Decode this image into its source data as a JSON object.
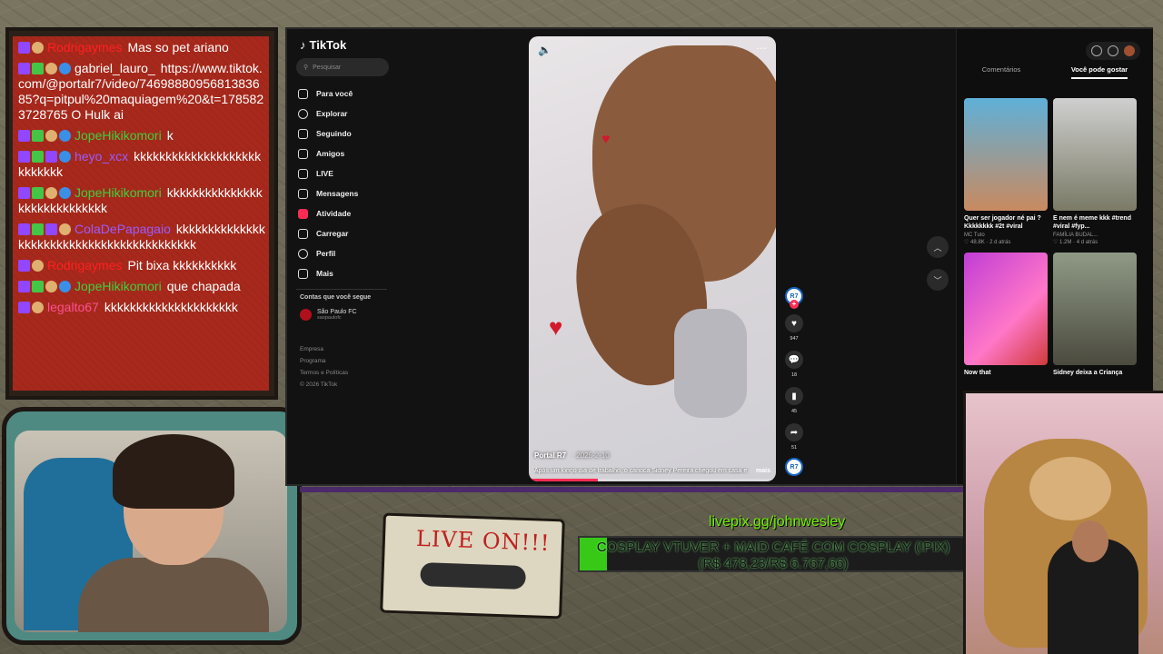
{
  "chat": {
    "messages": [
      {
        "user": "Rodrigaymes",
        "user_color": "#ff2020",
        "text": "Mas so pet ariano",
        "badges": [
          "purple",
          "face"
        ]
      },
      {
        "user": "gabriel_lauro_",
        "user_color": "#ffffff",
        "text": "https://www.tiktok.com/@portalr7/video/7469888095681383685?q=pitpul%20maquiagem%20&t=1785823728765 O Hulk ai",
        "badges": [
          "purple",
          "green",
          "face",
          "blue"
        ]
      },
      {
        "user": "JopeHikikomori",
        "user_color": "#3cd13c",
        "text": "k",
        "badges": [
          "purple",
          "green",
          "face",
          "blue"
        ]
      },
      {
        "user": "heyo_xcx",
        "user_color": "#9b5cff",
        "text": "kkkkkkkkkkkkkkkkkkkkkkkkkkk",
        "badges": [
          "purple",
          "green",
          "purple",
          "blue"
        ]
      },
      {
        "user": "JopeHikikomori",
        "user_color": "#3cd13c",
        "text": "kkkkkkkkkkkkkkkkkkkkkkkkkkkkk",
        "badges": [
          "purple",
          "green",
          "face",
          "blue"
        ]
      },
      {
        "user": "ColaDePapagaio",
        "user_color": "#9b5cff",
        "text": "kkkkkkkkkkkkkkkkkkkkkkkkkkkkkkkkkkkkkkkkkk",
        "badges": [
          "purple",
          "green",
          "purple",
          "face"
        ]
      },
      {
        "user": "Rodrigaymes",
        "user_color": "#ff2020",
        "text": "Pit bixa kkkkkkkkkk",
        "badges": [
          "purple",
          "face"
        ]
      },
      {
        "user": "JopeHikikomori",
        "user_color": "#3cd13c",
        "text": "que chapada",
        "badges": [
          "purple",
          "green",
          "face",
          "blue"
        ]
      },
      {
        "user": "legalto67",
        "user_color": "#ff4f8f",
        "text": "kkkkkkkkkkkkkkkkkkkkk",
        "badges": [
          "purple",
          "face"
        ]
      }
    ]
  },
  "tiktok": {
    "logo": "TikTok",
    "search_placeholder": "Pesquisar",
    "nav": [
      {
        "label": "Para você",
        "icon": "home-icon"
      },
      {
        "label": "Explorar",
        "icon": "compass-icon"
      },
      {
        "label": "Seguindo",
        "icon": "following-icon"
      },
      {
        "label": "Amigos",
        "icon": "friends-icon"
      },
      {
        "label": "LIVE",
        "icon": "live-icon"
      },
      {
        "label": "Mensagens",
        "icon": "messages-icon"
      },
      {
        "label": "Atividade",
        "icon": "activity-icon"
      },
      {
        "label": "Carregar",
        "icon": "upload-icon"
      },
      {
        "label": "Perfil",
        "icon": "profile-icon"
      },
      {
        "label": "Mais",
        "icon": "more-icon"
      }
    ],
    "following_heading": "Contas que você segue",
    "following": [
      {
        "name": "São Paulo FC",
        "handle": "saopaulofc"
      }
    ],
    "footer_links": [
      "Empresa",
      "Programa",
      "Termos e Políticas",
      "© 2026 TikTok"
    ],
    "video": {
      "author": "Portal R7",
      "date": "· 2025-2-10",
      "caption": "Após um longo dia de trabalho, o carioca Sidney Pereira chegou em casa e",
      "more": "mais",
      "progress": 0.28
    },
    "actions": {
      "avatar_label": "R7",
      "likes": "947",
      "comments": "18",
      "saves": "45",
      "shares": "51"
    },
    "right_panel": {
      "tabs": [
        "Comentários",
        "Você pode gostar"
      ],
      "active_tab": "Você pode gostar",
      "cards": [
        {
          "title": "Quer ser jogador né pai ? Kkkkkkkk #2t #viral",
          "author": "MC Tuto",
          "likes": "48.8K",
          "age": "2 d atrás"
        },
        {
          "title": "E nem é meme kkk #trend #viral #fyp...",
          "author": "FAMÍLIA BUDAL...",
          "likes": "1.2M",
          "age": "4 d atrás"
        },
        {
          "title": "Now that",
          "author": "",
          "likes": "",
          "age": ""
        },
        {
          "title": "Sidney deixa a Criança",
          "author": "",
          "likes": "",
          "age": ""
        }
      ]
    }
  },
  "overlay": {
    "cassette_label": "LIVE ON!!!",
    "livepix_url": "livepix.gg/johnwesley",
    "goal_title": "COSPLAY VTUVER + MAID CAFÉ COM COSPLAY (!PIX)",
    "goal_amount": "(R$ 478,23/R$ 6.767,66)",
    "goal_fraction": 0.07
  }
}
